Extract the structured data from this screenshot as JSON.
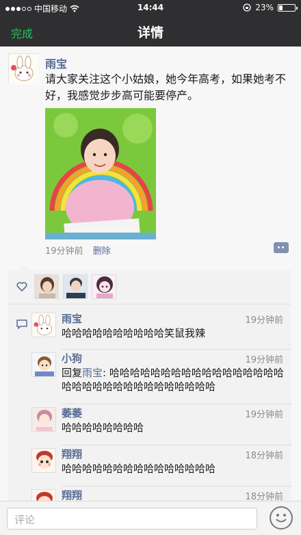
{
  "status": {
    "carrier": "中国移动",
    "time": "14:44",
    "battery": "23%",
    "battery_level": 0.23
  },
  "nav": {
    "done_label": "完成",
    "title": "详情"
  },
  "post": {
    "author": "雨宝",
    "text": "请大家关注这个小姑娘，她今年高考，如果她考不好，我感觉步步高可能要停产。",
    "time": "19分钟前",
    "delete_label": "删除"
  },
  "comments": [
    {
      "name": "雨宝",
      "time": "19分钟前",
      "text": "哈哈哈哈哈哈哈哈哈哈笑鼠我辣"
    },
    {
      "name": "小狗",
      "time": "19分钟前",
      "reply_prefix": "回复",
      "reply_to": "雨宝",
      "text": ": 哈哈哈哈哈哈哈哈哈哈哈哈哈哈哈哈哈哈哈哈哈哈哈哈哈哈哈哈哈哈哈哈"
    },
    {
      "name": "萎萎",
      "time": "19分钟前",
      "text": "哈哈哈哈哈哈哈哈"
    },
    {
      "name": "翔翔",
      "time": "18分钟前",
      "text": "哈哈哈哈哈哈哈哈哈哈哈哈哈哈哈"
    },
    {
      "name": "翔翔",
      "time": "18分钟前",
      "text": ""
    }
  ],
  "input": {
    "placeholder": "评论"
  },
  "colors": {
    "accent_green": "#25c35b",
    "link_blue": "#576b95",
    "nav_bg": "#2f2f31"
  }
}
